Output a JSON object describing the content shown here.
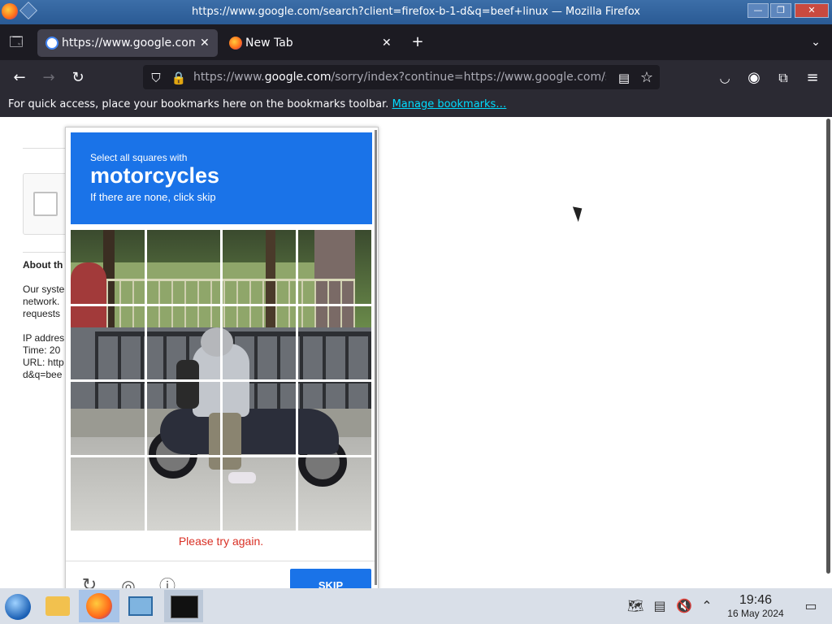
{
  "window": {
    "title": "https://www.google.com/search?client=firefox-b-1-d&q=beef+linux — Mozilla Firefox",
    "controls": [
      "—",
      "❐",
      "✕"
    ]
  },
  "tabs": [
    {
      "label": "https://www.google.com/",
      "active": true
    },
    {
      "label": "New Tab",
      "active": false
    }
  ],
  "new_tab_symbol": "+",
  "nav": {
    "url_host_prefix": "https://www.",
    "url_domain": "google.com",
    "url_rest": "/sorry/index?continue=https://www.google.com/s"
  },
  "bookmarks_bar": {
    "message": "For quick access, place your bookmarks here on the bookmarks toolbar.",
    "link": "Manage bookmarks…"
  },
  "page": {
    "about_heading": "About th",
    "para_lines": [
      "Our syste",
      "network.",
      "requests"
    ],
    "ip_label": "IP addres",
    "time_label": "Time: 20",
    "url_label": "URL: http",
    "url_label2": "d&q=bee"
  },
  "captcha": {
    "instruction_small": "Select all squares with",
    "target": "motorcycles",
    "instruction_sub": "If there are none, click skip",
    "error": "Please try again.",
    "skip_label": "SKIP",
    "colors": {
      "header": "#1a73e8",
      "error": "#d93025"
    }
  },
  "taskbar": {
    "time": "19:46",
    "date": "16 May 2024",
    "apps": [
      "start-menu",
      "file-manager",
      "firefox",
      "control-panel",
      "terminal"
    ]
  }
}
